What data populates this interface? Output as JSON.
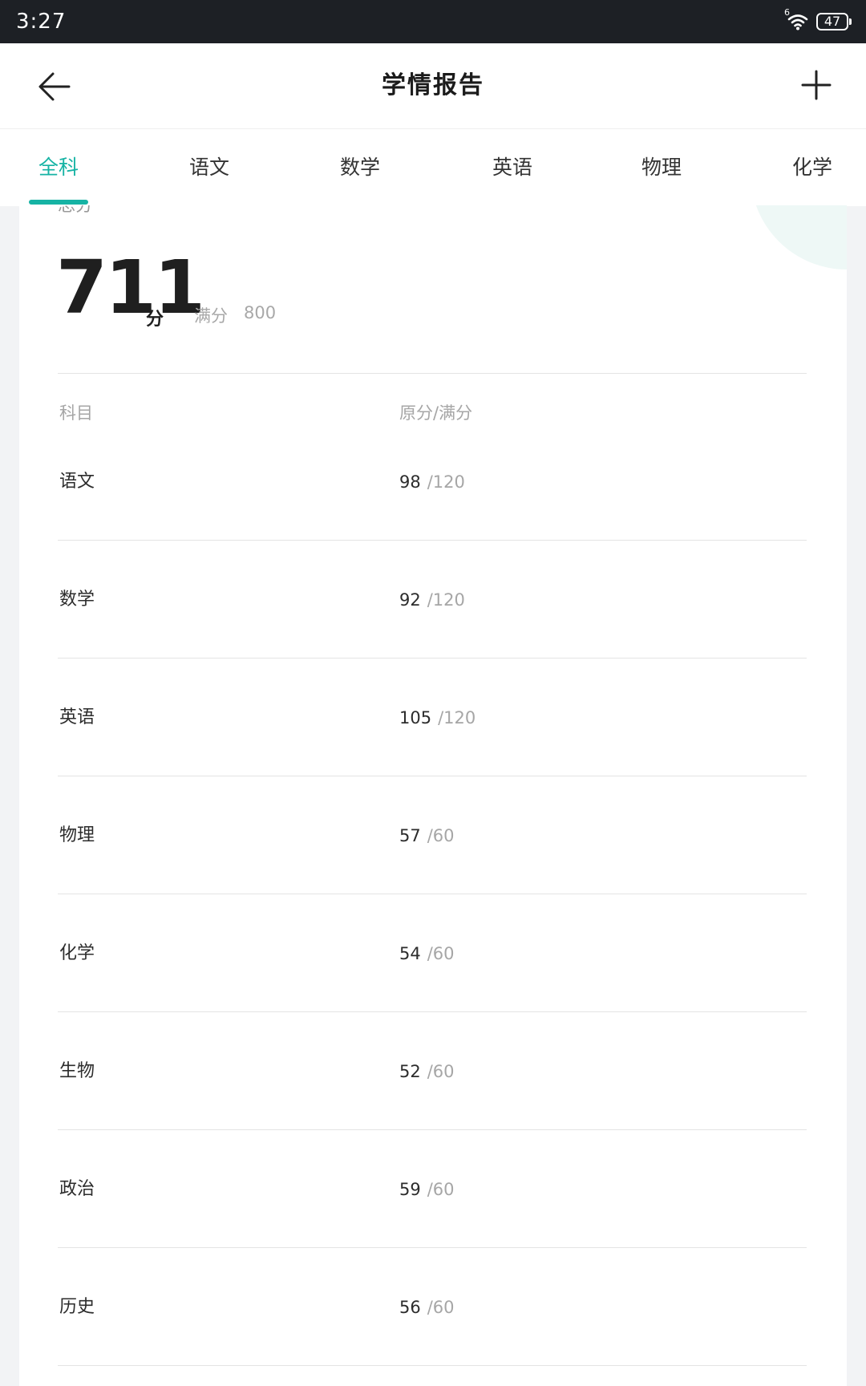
{
  "status_bar": {
    "time": "3:27",
    "signal_label": "6",
    "battery": "47"
  },
  "header": {
    "title": "学情报告",
    "back_icon": "arrow-left-icon",
    "add_icon": "plus-icon"
  },
  "tabs": [
    {
      "label": "全科",
      "active": true
    },
    {
      "label": "语文",
      "active": false
    },
    {
      "label": "数学",
      "active": false
    },
    {
      "label": "英语",
      "active": false
    },
    {
      "label": "物理",
      "active": false
    },
    {
      "label": "化学",
      "active": false
    }
  ],
  "summary": {
    "cut_label": "总分",
    "total": "711",
    "unit": "分",
    "full_label": "满分",
    "full_value": "800"
  },
  "table": {
    "headers": {
      "subject": "科目",
      "score": "原分/满分"
    },
    "rows": [
      {
        "subject": "语文",
        "raw": "98",
        "full": "/120"
      },
      {
        "subject": "数学",
        "raw": "92",
        "full": "/120"
      },
      {
        "subject": "英语",
        "raw": "105",
        "full": "/120"
      },
      {
        "subject": "物理",
        "raw": "57",
        "full": "/60"
      },
      {
        "subject": "化学",
        "raw": "54",
        "full": "/60"
      },
      {
        "subject": "生物",
        "raw": "52",
        "full": "/60"
      },
      {
        "subject": "政治",
        "raw": "59",
        "full": "/60"
      },
      {
        "subject": "历史",
        "raw": "56",
        "full": "/60"
      }
    ]
  },
  "colors": {
    "accent": "#16b3a4",
    "status_bar_bg": "#1d2025"
  }
}
